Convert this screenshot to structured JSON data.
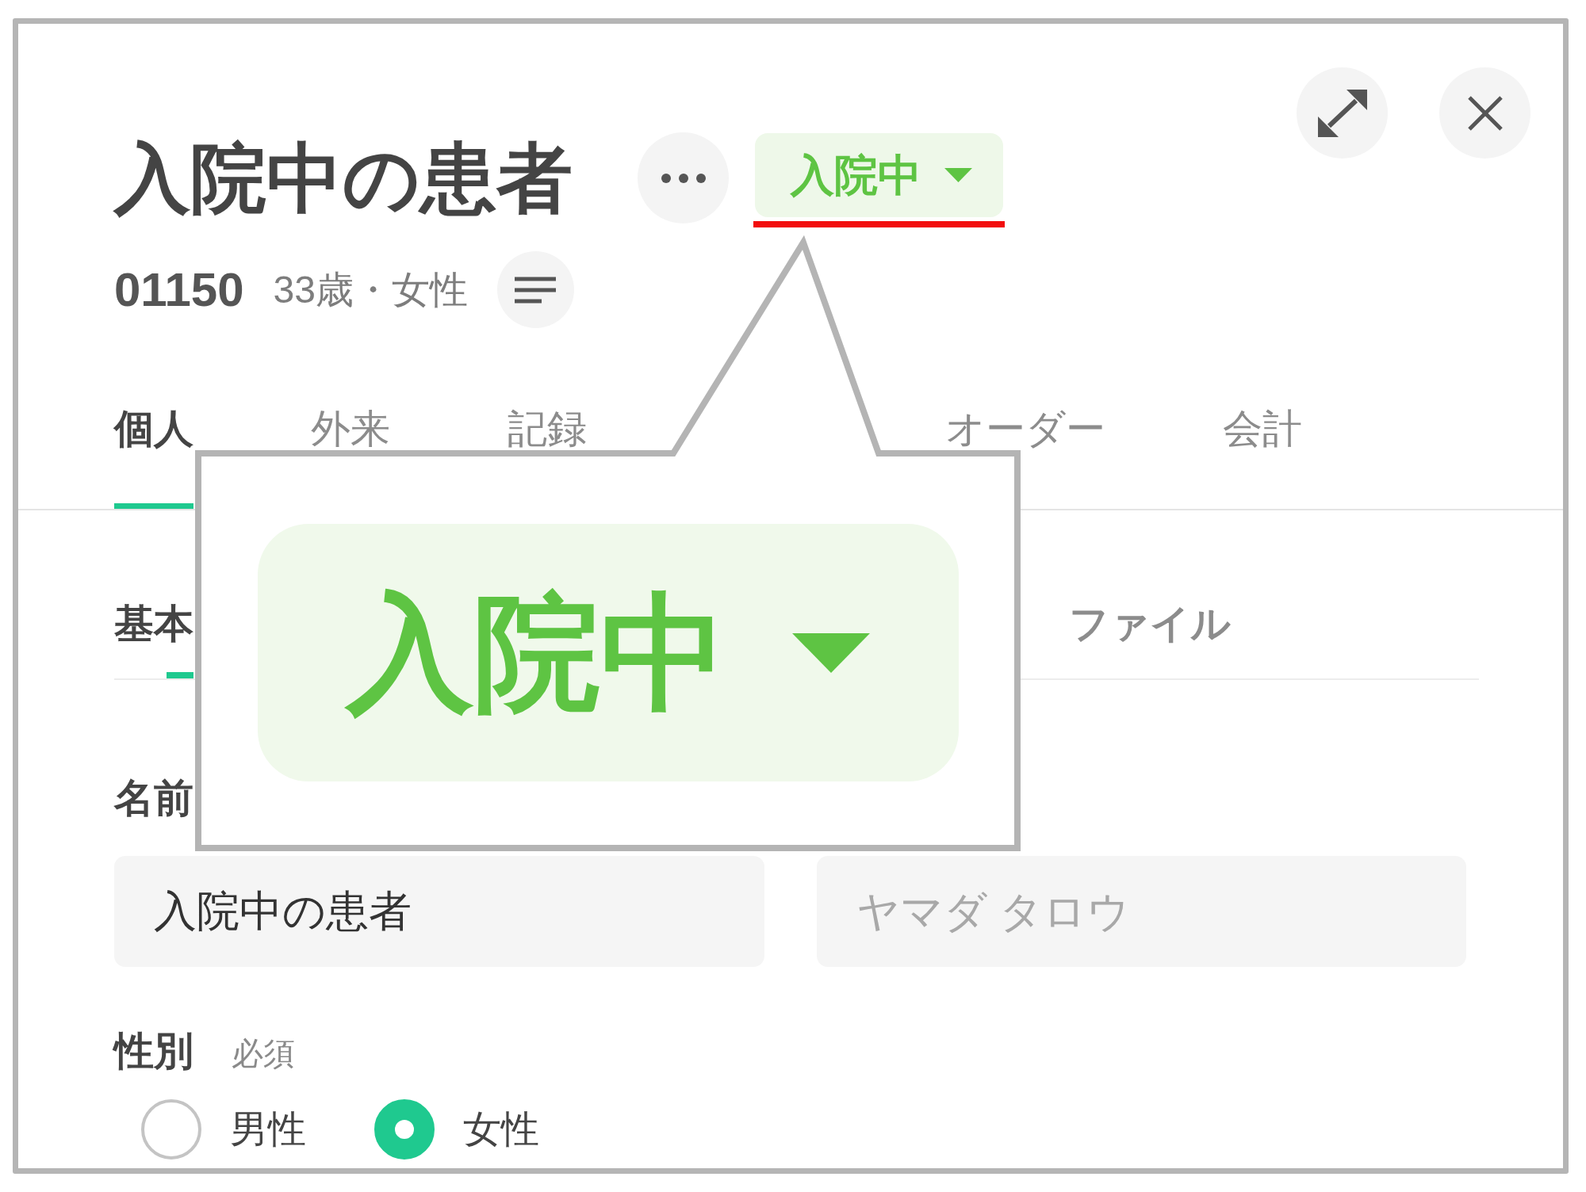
{
  "header": {
    "patient_name": "入院中の患者",
    "status": {
      "label": "入院中"
    },
    "patient_id": "01150",
    "age_sex": "33歳・女性"
  },
  "tabs": [
    {
      "label": "個人",
      "selected": true
    },
    {
      "label": "外来",
      "selected": false
    },
    {
      "label": "記録",
      "selected": false
    },
    {
      "label": "オーダー",
      "selected": false
    },
    {
      "label": "会計",
      "selected": false
    }
  ],
  "sub_tabs": [
    {
      "label": "基本",
      "selected": true
    },
    {
      "label": "ファイル",
      "selected": false
    }
  ],
  "form": {
    "name_label": "名前",
    "name_value": "入院中の患者",
    "kana_placeholder": "ヤマダ タロウ",
    "sex_label": "性別",
    "sex_required": "必須",
    "sex_options": [
      {
        "label": "男性",
        "selected": false
      },
      {
        "label": "女性",
        "selected": true
      }
    ]
  },
  "callout": {
    "badge_label": "入院中"
  }
}
